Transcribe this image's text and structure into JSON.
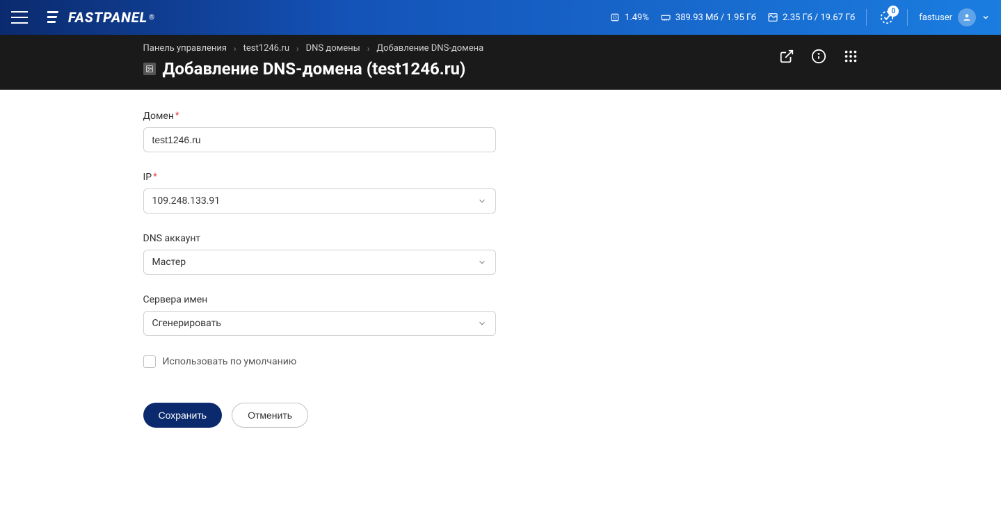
{
  "brand": "FASTPANEL",
  "topbar": {
    "cpu": "1.49%",
    "memory": "389.93 Мб / 1.95 Гб",
    "disk": "2.35 Гб / 19.67 Гб",
    "notif_count": "0",
    "username": "fastuser"
  },
  "breadcrumb": {
    "items": [
      "Панель управления",
      "test1246.ru",
      "DNS домены",
      "Добавление DNS-домена"
    ]
  },
  "page": {
    "title": "Добавление DNS-домена (test1246.ru)"
  },
  "form": {
    "domain_label": "Домен",
    "domain_value": "test1246.ru",
    "ip_label": "IP",
    "ip_value": "109.248.133.91",
    "dns_account_label": "DNS аккаунт",
    "dns_account_value": "Мастер",
    "ns_label": "Сервера имен",
    "ns_value": "Сгенерировать",
    "default_checkbox_label": "Использовать по умолчанию",
    "save_label": "Сохранить",
    "cancel_label": "Отменить"
  }
}
